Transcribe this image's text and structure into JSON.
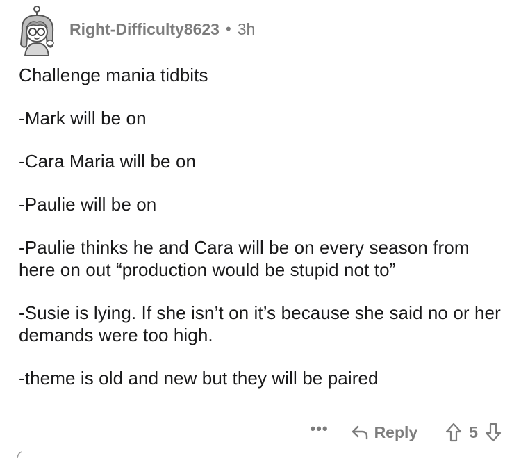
{
  "comment": {
    "username": "Right-Difficulty8623",
    "separator": "•",
    "timestamp": "3h",
    "avatar_icon": "cartoon-avatar-icon",
    "paragraphs": [
      "Challenge mania tidbits",
      "-Mark will be on",
      "-Cara Maria will be on",
      "-Paulie will be on",
      "-Paulie thinks he and Cara will be on every season from here on out “production would be stupid not to”",
      "-Susie is lying. If she isn’t on it’s because she said no or her demands were too high.",
      "-theme is old and new but they will be paired"
    ]
  },
  "actions": {
    "more_label": "•••",
    "reply_label": "Reply",
    "score": "5",
    "icons": [
      "more-icon",
      "reply-arrow-icon",
      "upvote-icon",
      "downvote-icon"
    ]
  },
  "colors": {
    "text": "#1a1a1b",
    "meta": "#7c7c7c",
    "background": "#ffffff"
  }
}
